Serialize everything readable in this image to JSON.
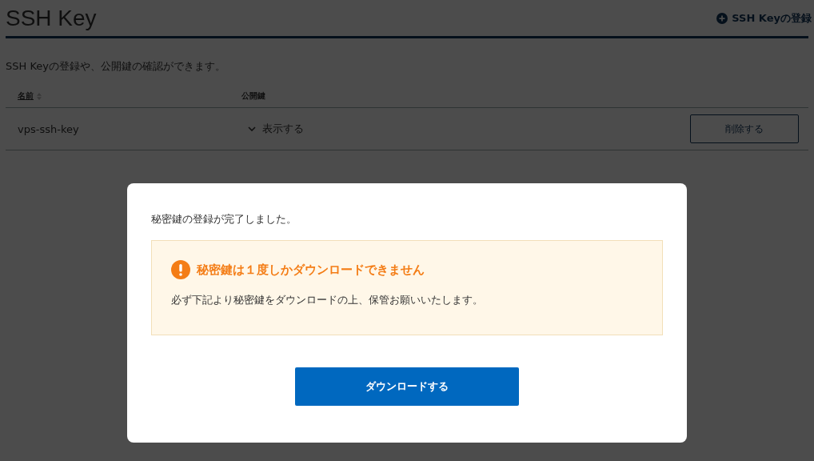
{
  "page": {
    "title": "SSH Key",
    "add_link": "SSH Keyの登録",
    "description": "SSH Keyの登録や、公開鍵の確認ができます。"
  },
  "table": {
    "columns": [
      {
        "label": "名前",
        "sortable": true
      },
      {
        "label": "公開鍵",
        "sortable": false
      }
    ],
    "rows": [
      {
        "name": "vps-ssh-key",
        "toggle": "表示する",
        "expanded": false,
        "action": "削除する"
      }
    ]
  },
  "modal": {
    "message": "秘密鍵の登録が完了しました。",
    "warning": {
      "title": "秘密鍵は１度しかダウンロードできません",
      "body": "必ず下記より秘密鍵をダウンロードの上、保管お願いいたします。"
    },
    "button": "ダウンロードする"
  }
}
